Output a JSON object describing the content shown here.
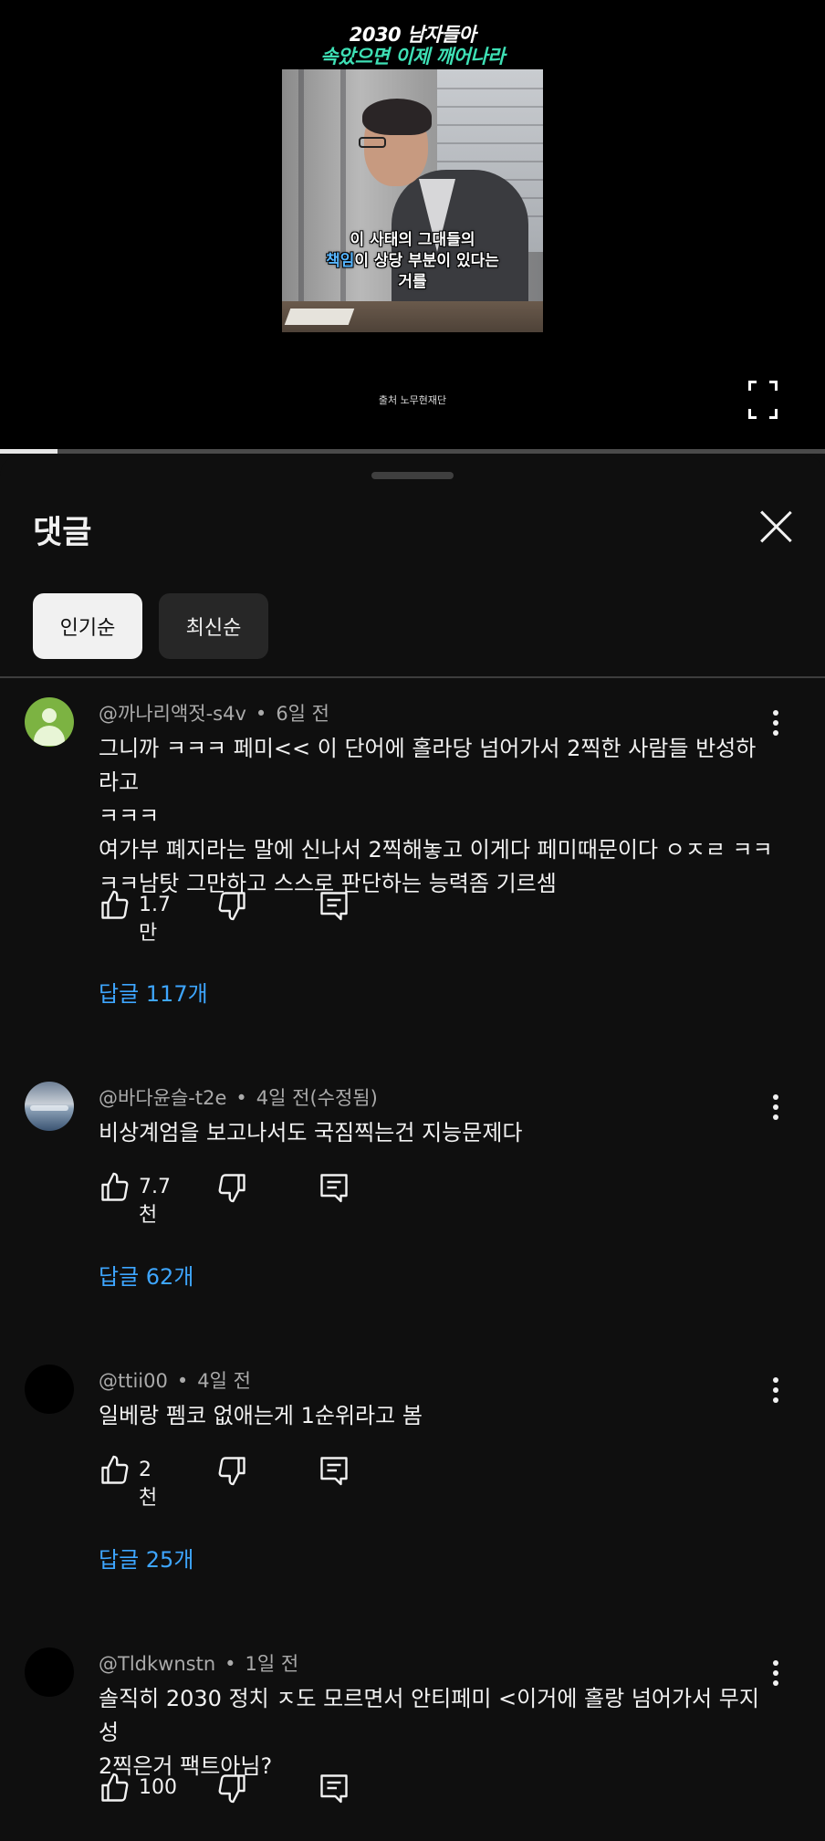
{
  "video": {
    "title_line1": "2030 남자들아",
    "title_line2": "속았으면 이제 깨어나라",
    "caption_line1": "이 사태의 그대들의",
    "caption_highlight": "책임",
    "caption_line2_rest": "이 상당 부분이 있다는",
    "caption_line3": "거를",
    "source": "출처 노무현재단",
    "progress_fraction": 0.07
  },
  "sheet": {
    "title": "댓글",
    "chips": [
      {
        "label": "인기순",
        "selected": true
      },
      {
        "label": "최신순",
        "selected": false
      }
    ]
  },
  "comments": [
    {
      "author": "@까나리액젓-s4v",
      "time": "6일 전",
      "text_lines": [
        "그니까 ㅋㅋㅋ 페미<< 이 단어에 홀라당 넘어가서 2찍한 사람들 반성하라고",
        "ㅋㅋㅋ",
        "여가부 폐지라는 말에 신나서 2찍해놓고 이게다 페미때문이다 ㅇㅈㄹ ㅋㅋ",
        "ㅋㅋ남탓 그만하고 스스로 판단하는 능력좀 기르셈"
      ],
      "likes": "1.7만",
      "replies": "답글 117개",
      "avatar": "green-default"
    },
    {
      "author": "@바다윤슬-t2e",
      "time": "4일 전(수정됨)",
      "text_lines": [
        "비상계엄을 보고나서도 국짐찍는건 지능문제다"
      ],
      "likes": "7.7천",
      "replies": "답글 62개",
      "avatar": "sea-photo"
    },
    {
      "author": "@ttii00",
      "time": "4일 전",
      "text_lines": [
        "일베랑 펨코 없애는게 1순위라고 봄"
      ],
      "likes": "2천",
      "replies": "답글 25개",
      "avatar": "black"
    },
    {
      "author": "@Tldkwnstn",
      "time": "1일 전",
      "text_lines": [
        "솔직히 2030 정치 ㅈ도 모르면서 안티페미 <이거에 홀랑 넘어가서 무지성",
        "2찍은거 팩트아님?"
      ],
      "likes": "100",
      "replies": "",
      "avatar": "black"
    }
  ],
  "icons": {
    "like": "thumbs-up-icon",
    "dislike": "thumbs-down-icon",
    "reply": "reply-comment-icon",
    "more": "more-vertical-icon",
    "close": "close-icon",
    "fullscreen": "fullscreen-icon"
  },
  "colors": {
    "background": "#0f0f0f",
    "reply_link": "#3ea6ff",
    "chip_active_bg": "#f1f1f1",
    "chip_inactive_bg": "#272727",
    "title_accent": "#3ee0b5",
    "caption_highlight": "#57b6ff"
  }
}
